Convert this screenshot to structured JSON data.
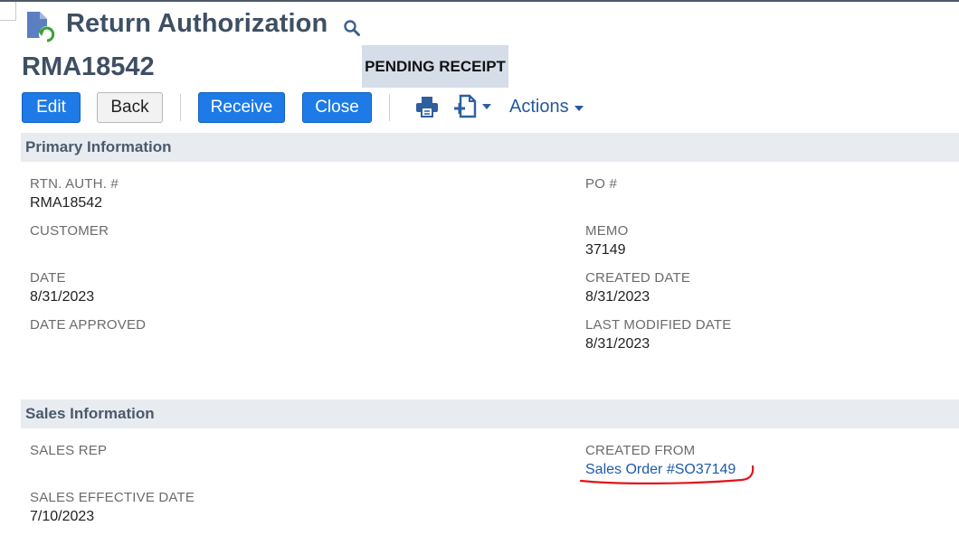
{
  "header": {
    "page_title": "Return Authorization",
    "record_id": "RMA18542",
    "status": "PENDING RECEIPT"
  },
  "toolbar": {
    "edit_label": "Edit",
    "back_label": "Back",
    "receive_label": "Receive",
    "close_label": "Close",
    "actions_label": "Actions",
    "icons": [
      "print-icon",
      "new-document-icon"
    ]
  },
  "primary": {
    "title": "Primary Information",
    "rtn_auth_label": "RTN. AUTH. #",
    "rtn_auth_value": "RMA18542",
    "customer_label": "CUSTOMER",
    "date_label": "DATE",
    "date_value": "8/31/2023",
    "date_approved_label": "DATE APPROVED",
    "po_label": "PO #",
    "memo_label": "MEMO",
    "memo_value": "37149",
    "created_date_label": "CREATED DATE",
    "created_date_value": "8/31/2023",
    "last_modified_label": "LAST MODIFIED DATE",
    "last_modified_value": "8/31/2023"
  },
  "sales": {
    "title": "Sales Information",
    "sales_rep_label": "SALES REP",
    "sales_effective_label": "SALES EFFECTIVE DATE",
    "sales_effective_value": "7/10/2023",
    "created_from_label": "CREATED FROM",
    "created_from_value": "Sales Order #SO37149"
  },
  "colors": {
    "primary_button": "#1d7ae6",
    "title_text": "#3f4f63",
    "link": "#1e5aa8",
    "section_bar": "#e8ebf0",
    "status_badge": "#d5dde9",
    "annotation": "#e0151c"
  }
}
